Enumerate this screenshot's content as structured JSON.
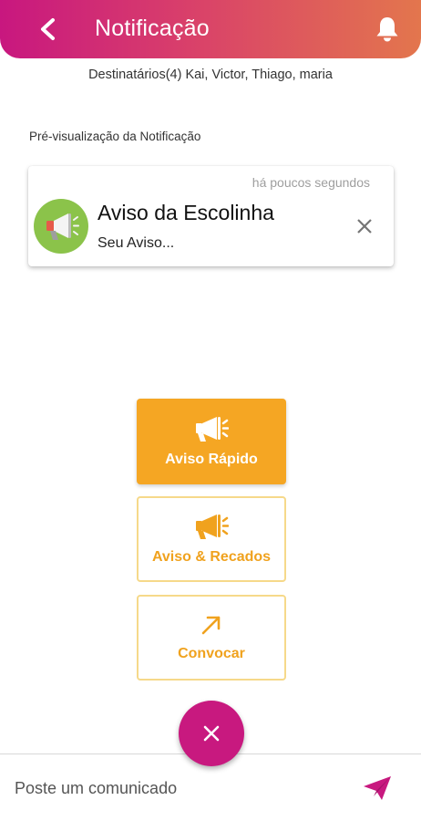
{
  "header": {
    "title": "Notificação",
    "back_icon": "chevron-left-icon",
    "bell_icon": "bell-icon"
  },
  "recipients": {
    "text": "Destinatários(4) Kai, Victor, Thiago, maria"
  },
  "preview": {
    "label": "Pré-visualização da Notificação",
    "time": "há poucos segundos",
    "title": "Aviso da Escolinha",
    "body": "Seu Aviso...",
    "avatar_icon": "megaphone-icon",
    "close_icon": "close-icon"
  },
  "options": {
    "quick": {
      "label": "Aviso Rápido",
      "icon": "megaphone-icon"
    },
    "recados": {
      "label": "Aviso & Recados",
      "icon": "megaphone-icon"
    },
    "convocar": {
      "label": "Convocar",
      "icon": "arrow-up-right-icon"
    }
  },
  "fab": {
    "icon": "close-icon"
  },
  "composer": {
    "placeholder": "Poste um comunicado",
    "value": "",
    "send_icon": "send-icon"
  },
  "colors": {
    "header_start": "#c8177f",
    "header_end": "#e3764d",
    "accent_orange": "#f5a623",
    "outline_gold": "#f6d98a",
    "fab_magenta": "#c8197f",
    "avatar_green": "#8bc34a"
  }
}
